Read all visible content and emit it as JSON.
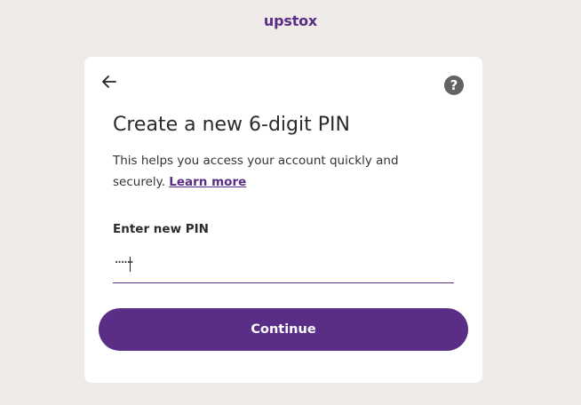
{
  "brand": {
    "logo_text": "upstox",
    "accent_color": "#5a2d86"
  },
  "card": {
    "back_icon": "arrow-left-icon",
    "help_icon": "question-circle-icon",
    "help_glyph": "?",
    "title": "Create a new 6-digit PIN",
    "description": "This helps you access your account quickly and securely.",
    "learn_more_link": "Learn more",
    "pin_field": {
      "label": "Enter new PIN",
      "masked_value": "······"
    },
    "continue_button": "Continue"
  }
}
